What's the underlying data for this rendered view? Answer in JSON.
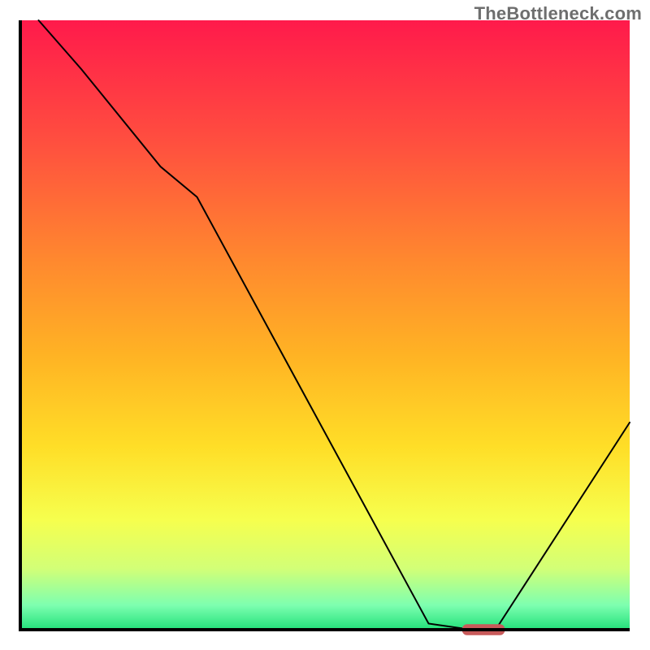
{
  "watermark": "TheBottleneck.com",
  "chart_data": {
    "type": "line",
    "title": "",
    "xlabel": "",
    "ylabel": "",
    "xlim": [
      0,
      100
    ],
    "ylim": [
      0,
      100
    ],
    "background": {
      "type": "vertical-gradient",
      "stops": [
        {
          "offset": 0.0,
          "color": "#ff1a4b"
        },
        {
          "offset": 0.2,
          "color": "#ff4f3f"
        },
        {
          "offset": 0.4,
          "color": "#ff8a2e"
        },
        {
          "offset": 0.55,
          "color": "#ffb324"
        },
        {
          "offset": 0.7,
          "color": "#ffde27"
        },
        {
          "offset": 0.82,
          "color": "#f6ff4e"
        },
        {
          "offset": 0.9,
          "color": "#d2ff77"
        },
        {
          "offset": 0.96,
          "color": "#7dffb0"
        },
        {
          "offset": 1.0,
          "color": "#22e07a"
        }
      ]
    },
    "series": [
      {
        "name": "bottleneck-curve",
        "color": "#000000",
        "stroke_width": 2,
        "x": [
          3,
          10,
          23,
          29,
          67,
          74,
          78,
          100
        ],
        "values": [
          100,
          92,
          76,
          71,
          1,
          0,
          0,
          34
        ]
      }
    ],
    "marker": {
      "name": "selected-point",
      "color": "#c85a5a",
      "x": 76,
      "y": 0,
      "half_width": 3.5,
      "half_height": 0.9
    },
    "frame_color": "#000000"
  }
}
